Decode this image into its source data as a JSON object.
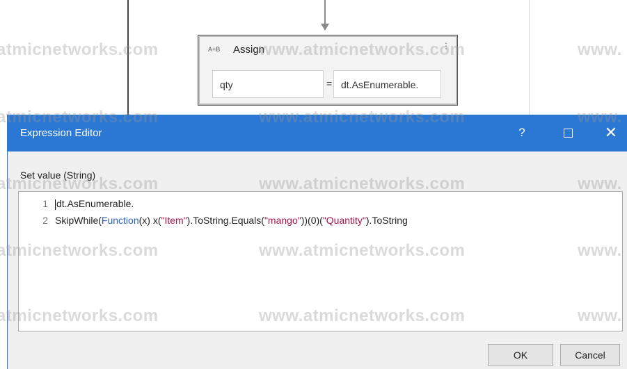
{
  "assign": {
    "icon": "A+B",
    "title": "Assign",
    "to_value": "qty",
    "equals": "=",
    "value": "dt.AsEnumerable."
  },
  "dialog": {
    "title": "Expression Editor",
    "help": "?",
    "close": "✕",
    "set_label": "Set value (String)",
    "lines": [
      {
        "num": "1",
        "text": "dt.AsEnumerable."
      },
      {
        "num": "2",
        "p1": "SkipWhile(",
        "kw1": "Function",
        "p2": "(x) x(",
        "s1": "\"Item\"",
        "p3": ").ToString.Equals(",
        "s2": "\"mango\"",
        "p4": "))(0)(",
        "s3": "\"Quantity\"",
        "p5": ").ToString"
      }
    ],
    "ok_label": "OK",
    "cancel_label": "Cancel"
  },
  "watermark": {
    "text_left": "atmicnetworks.com",
    "text_mid": "www.atmicnetworks.com",
    "text_right": "www."
  },
  "colors": {
    "titlebar": "#2b78d4",
    "keyword": "#2b5fb8",
    "string": "#a3154b"
  }
}
